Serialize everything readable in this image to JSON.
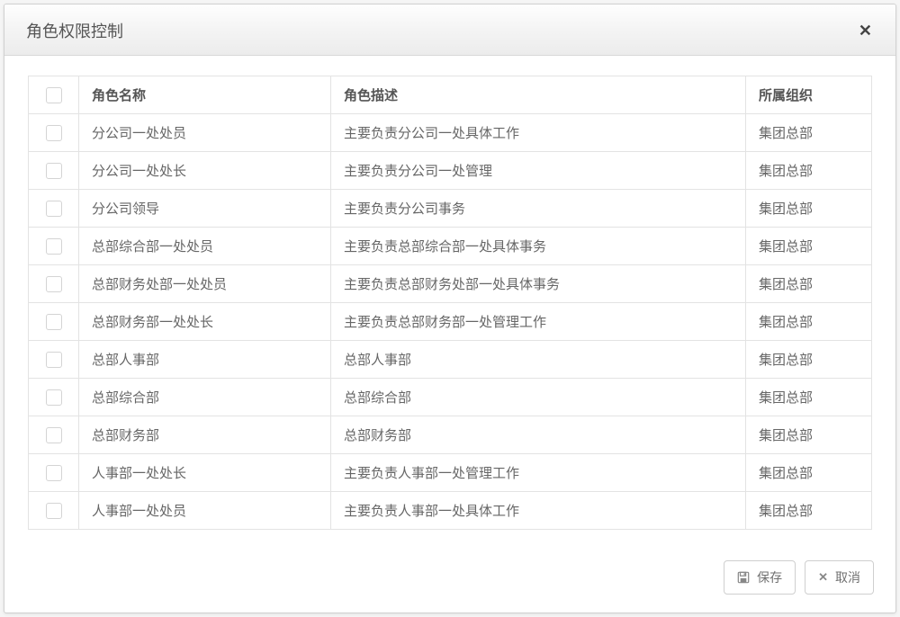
{
  "dialog": {
    "title": "角色权限控制"
  },
  "table": {
    "headers": {
      "name": "角色名称",
      "desc": "角色描述",
      "org": "所属组织"
    },
    "rows": [
      {
        "name": "分公司一处处员",
        "desc": "主要负责分公司一处具体工作",
        "org": "集团总部"
      },
      {
        "name": "分公司一处处长",
        "desc": "主要负责分公司一处管理",
        "org": "集团总部"
      },
      {
        "name": "分公司领导",
        "desc": "主要负责分公司事务",
        "org": "集团总部"
      },
      {
        "name": "总部综合部一处处员",
        "desc": "主要负责总部综合部一处具体事务",
        "org": "集团总部"
      },
      {
        "name": "总部财务处部一处处员",
        "desc": "主要负责总部财务处部一处具体事务",
        "org": "集团总部"
      },
      {
        "name": "总部财务部一处处长",
        "desc": "主要负责总部财务部一处管理工作",
        "org": "集团总部"
      },
      {
        "name": "总部人事部",
        "desc": "总部人事部",
        "org": "集团总部"
      },
      {
        "name": "总部综合部",
        "desc": "总部综合部",
        "org": "集团总部"
      },
      {
        "name": "总部财务部",
        "desc": "总部财务部",
        "org": "集团总部"
      },
      {
        "name": "人事部一处处长",
        "desc": "主要负责人事部一处管理工作",
        "org": "集团总部"
      },
      {
        "name": "人事部一处处员",
        "desc": "主要负责人事部一处具体工作",
        "org": "集团总部"
      }
    ]
  },
  "footer": {
    "save": "保存",
    "cancel": "取消"
  }
}
